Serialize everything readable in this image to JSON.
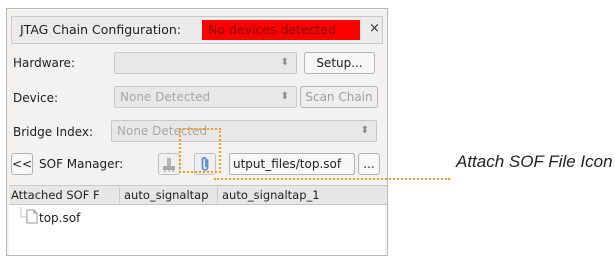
{
  "window": {
    "title": "JTAG Chain Configuration:",
    "status": "No devices detected",
    "close_glyph": "×"
  },
  "hardware": {
    "label": "Hardware:",
    "value": "",
    "setup_label": "Setup..."
  },
  "device": {
    "label": "Device:",
    "value": "None Detected",
    "scan_label": "Scan Chain"
  },
  "bridge": {
    "label": "Bridge Index:",
    "value": "None Detected"
  },
  "sof": {
    "collapse_label": "<<",
    "label": "SOF Manager:",
    "file_value": "utput_files/top.sof",
    "browse_label": "..."
  },
  "tabs": [
    "Attached SOF F",
    "auto_signaltap",
    "auto_signaltap_1"
  ],
  "tree": {
    "file": "top.sof"
  },
  "callout": {
    "label": "Attach SOF File Icon",
    "color": "#f39a2b"
  },
  "colors": {
    "status_bg": "#ff0000",
    "panel_bg": "#f3f2f1"
  }
}
